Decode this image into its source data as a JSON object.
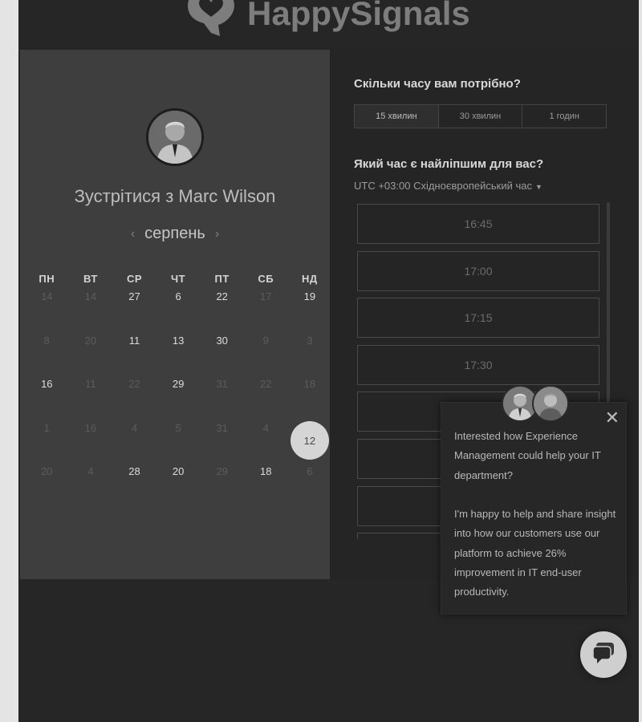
{
  "header": {
    "logo_text": "HappySignals"
  },
  "organizer": {
    "meet_title": "Зустрітися з Marc Wilson",
    "month": "серпень",
    "prev_icon": "chevron-left-icon",
    "next_icon": "chevron-right-icon"
  },
  "calendar": {
    "weekdays": [
      "ПН",
      "ВТ",
      "СР",
      "ЧТ",
      "ПТ",
      "СБ",
      "НД"
    ],
    "rows": [
      [
        {
          "d": "14",
          "on": false
        },
        {
          "d": "14",
          "on": false
        },
        {
          "d": "27",
          "on": true
        },
        {
          "d": "6",
          "on": true
        },
        {
          "d": "22",
          "on": true
        },
        {
          "d": "17",
          "on": false
        },
        {
          "d": "19",
          "on": true
        }
      ],
      [
        {
          "d": "8",
          "on": false
        },
        {
          "d": "20",
          "on": false
        },
        {
          "d": "11",
          "on": true
        },
        {
          "d": "13",
          "on": true
        },
        {
          "d": "30",
          "on": true
        },
        {
          "d": "9",
          "on": false
        },
        {
          "d": "3",
          "on": false
        }
      ],
      [
        {
          "d": "16",
          "on": true
        },
        {
          "d": "11",
          "on": false
        },
        {
          "d": "22",
          "on": false
        },
        {
          "d": "29",
          "on": true
        },
        {
          "d": "31",
          "on": false
        },
        {
          "d": "22",
          "on": false
        },
        {
          "d": "18",
          "on": false
        }
      ],
      [
        {
          "d": "1",
          "on": false
        },
        {
          "d": "16",
          "on": false
        },
        {
          "d": "4",
          "on": false
        },
        {
          "d": "5",
          "on": false
        },
        {
          "d": "31",
          "on": false
        },
        {
          "d": "4",
          "on": false
        },
        {
          "d": "12",
          "on": true,
          "selected": true
        }
      ],
      [
        {
          "d": "20",
          "on": false
        },
        {
          "d": "4",
          "on": false
        },
        {
          "d": "28",
          "on": true
        },
        {
          "d": "20",
          "on": true
        },
        {
          "d": "29",
          "on": false
        },
        {
          "d": "18",
          "on": true
        },
        {
          "d": "6",
          "on": false
        }
      ]
    ]
  },
  "scheduler": {
    "duration_question": "Скільки часу вам потрібно?",
    "durations": [
      "15 хвилин",
      "30 хвилин",
      "1 годин"
    ],
    "active_duration": 0,
    "time_question": "Який час є найліпшим для вас?",
    "timezone": "UTC +03:00 Східноєвропейський час",
    "timezone_icon": "caret-down-icon",
    "slots": [
      "16:45",
      "17:00",
      "17:15",
      "17:30",
      "",
      "",
      "",
      ""
    ]
  },
  "chat_popup": {
    "close_icon": "close-icon",
    "paragraph1": "Interested how Experience Management could help your IT department?",
    "paragraph2_lines": [
      "I'm happy to help and share insight into how our customers use our platform to achieve 26% improvement in IT end-user",
      "productivity."
    ]
  },
  "chat_button": {
    "icon": "chat-bubble-icon"
  }
}
